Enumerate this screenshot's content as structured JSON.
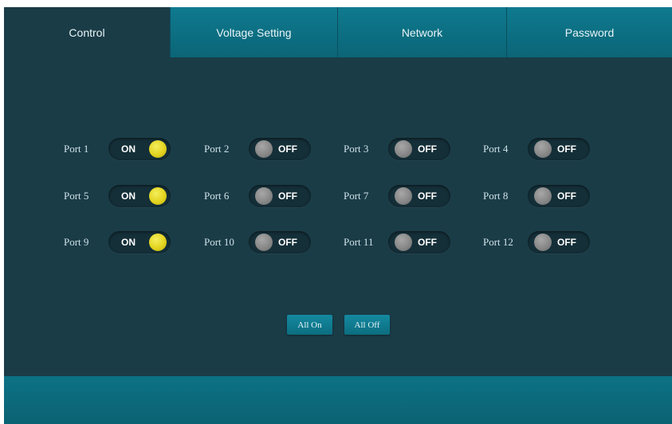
{
  "tabs": [
    {
      "label": "Control",
      "active": true
    },
    {
      "label": "Voltage Setting",
      "active": false
    },
    {
      "label": "Network",
      "active": false
    },
    {
      "label": "Password",
      "active": false
    }
  ],
  "ports": [
    {
      "label": "Port 1",
      "state": "ON"
    },
    {
      "label": "Port 2",
      "state": "OFF"
    },
    {
      "label": "Port 3",
      "state": "OFF"
    },
    {
      "label": "Port 4",
      "state": "OFF"
    },
    {
      "label": "Port 5",
      "state": "ON"
    },
    {
      "label": "Port 6",
      "state": "OFF"
    },
    {
      "label": "Port 7",
      "state": "OFF"
    },
    {
      "label": "Port 8",
      "state": "OFF"
    },
    {
      "label": "Port 9",
      "state": "ON"
    },
    {
      "label": "Port 10",
      "state": "OFF"
    },
    {
      "label": "Port 11",
      "state": "OFF"
    },
    {
      "label": "Port 12",
      "state": "OFF"
    }
  ],
  "actions": {
    "all_on": "All On",
    "all_off": "All Off"
  },
  "colors": {
    "background": "#1a3c47",
    "tab_inactive": "#0f7a8f",
    "knob_on": "#e3d41f",
    "knob_off": "#888888",
    "footer": "#0d7285"
  }
}
